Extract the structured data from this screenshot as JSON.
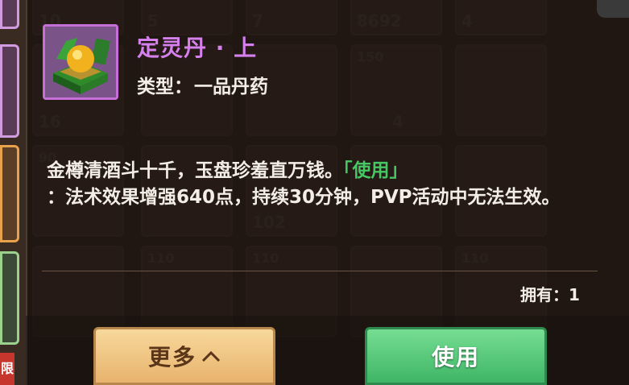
{
  "item": {
    "name": "定灵丹 · 上",
    "type_label": "类型：",
    "type_value": "一品丹药",
    "icon": "jade-box-pill-icon",
    "frame_color": "#c76fd8"
  },
  "description": {
    "text": "金樽清酒斗十千，玉盘珍羞直万钱。",
    "use_tag": "「使用」",
    "effect": "：法术效果增强640点，持续30分钟，PVP活动中无法生效。",
    "use_tag_color": "#45c764"
  },
  "owned": {
    "label": "拥有：",
    "count": "1"
  },
  "buttons": {
    "more_label": "更多",
    "more_icon": "chevron-up-icon",
    "use_label": "使用"
  },
  "background": {
    "inventory_counts": [
      "10",
      "5",
      "7",
      "8692",
      "4",
      "16",
      "150",
      "4",
      "90",
      "102",
      "110",
      "110",
      "110"
    ],
    "side_label": "限"
  },
  "colors": {
    "title": "#d580ec",
    "text": "#f2ede5",
    "more_button": "#e8b36d",
    "use_button": "#3fb566"
  }
}
